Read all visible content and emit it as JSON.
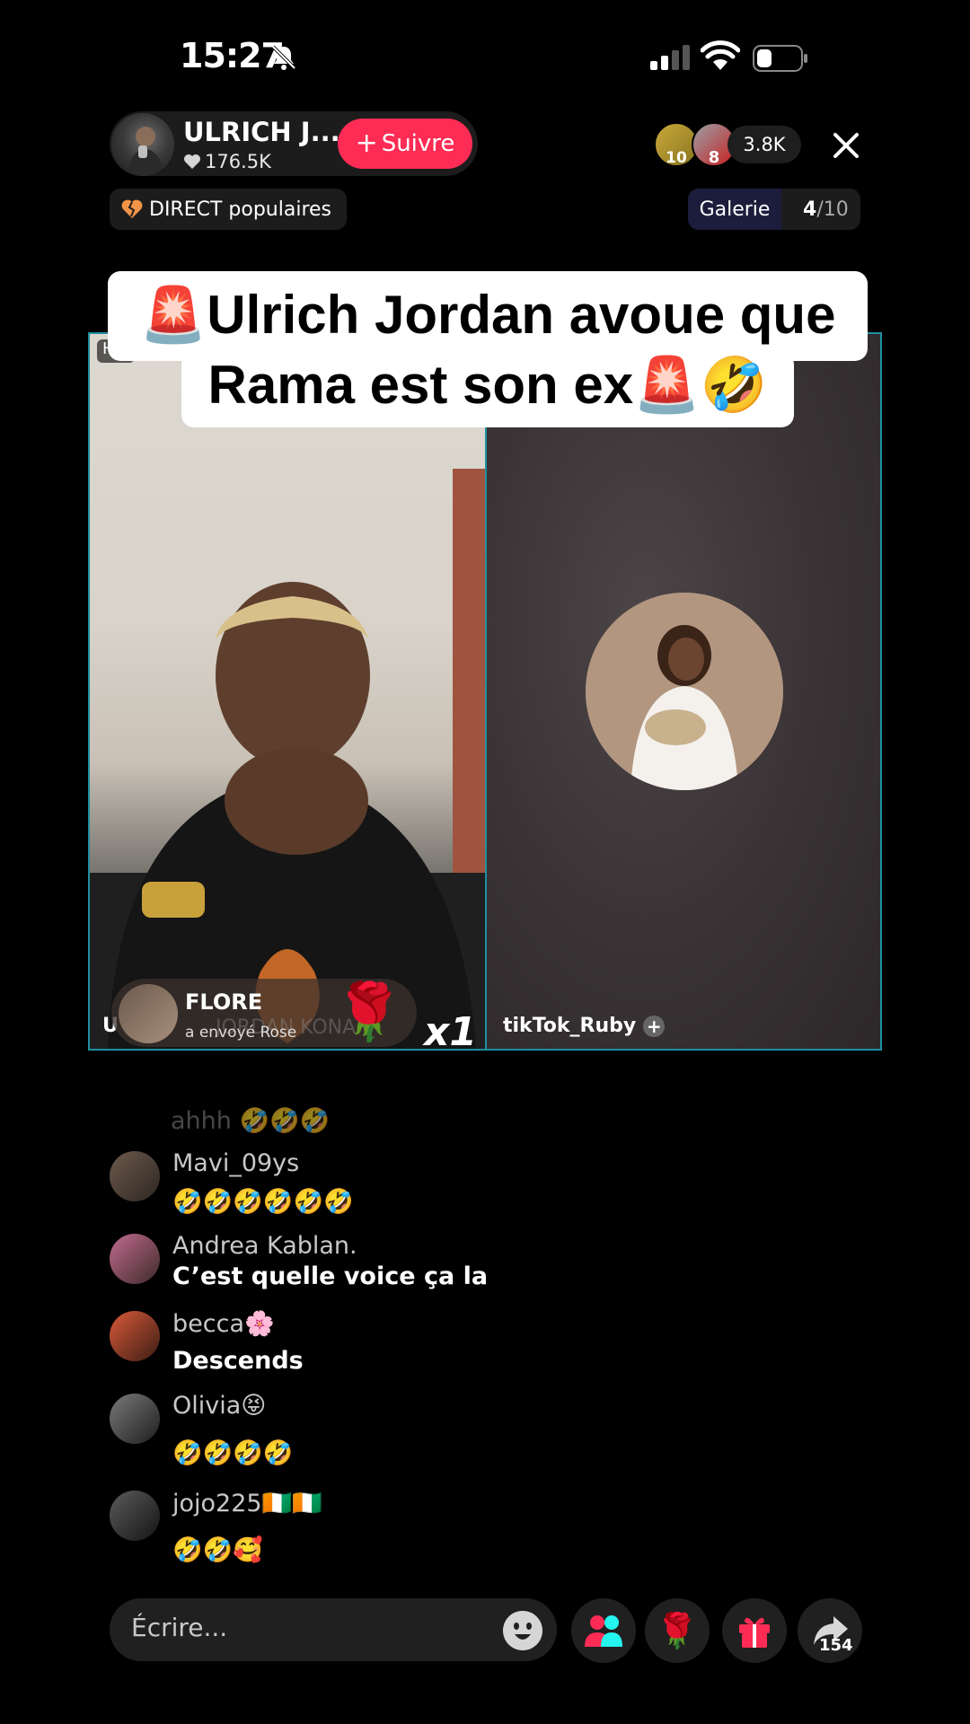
{
  "status_bar": {
    "time": "15:27"
  },
  "host": {
    "name": "ULRICH J...",
    "likes": "176.5K",
    "follow_label": "Suivre"
  },
  "viewers": {
    "badge_1": "10",
    "badge_2": "8",
    "count": "3.8K"
  },
  "chips": {
    "popular": "DIRECT populaires",
    "gallery": "Galerie",
    "gallery_current": "4",
    "gallery_total": "/10"
  },
  "caption": {
    "line1": "🚨Ulrich Jordan avoue que",
    "line2": "Rama est son ex🚨🤣"
  },
  "video": {
    "host_tag": "H",
    "host_overlay_initial": "U",
    "guest_name": "tikTok_Ruby"
  },
  "gift": {
    "user": "FLORE",
    "action": "a envoyé  Rose",
    "behind_text": "JORDAN KONAN",
    "combo": "x1"
  },
  "comments": [
    {
      "user": "Mavi_09ys",
      "text": "🤣🤣🤣🤣🤣🤣"
    },
    {
      "user": "Andrea Kablan.",
      "text": "C’est quelle voice ça la"
    },
    {
      "user": "becca🌸",
      "text": "Descends"
    },
    {
      "user": "Olivia😝",
      "text": "🤣🤣🤣🤣"
    },
    {
      "user": "jojo225🇨🇮🇨🇮",
      "text": "🤣🤣🥰"
    }
  ],
  "faded_comment": "ahhh 🤣🤣🤣",
  "bottom_bar": {
    "placeholder": "Écrire...",
    "share_count": "154"
  },
  "colors": {
    "accent": "#fe2c55",
    "frame": "#1f8fa1",
    "background": "#000000"
  }
}
